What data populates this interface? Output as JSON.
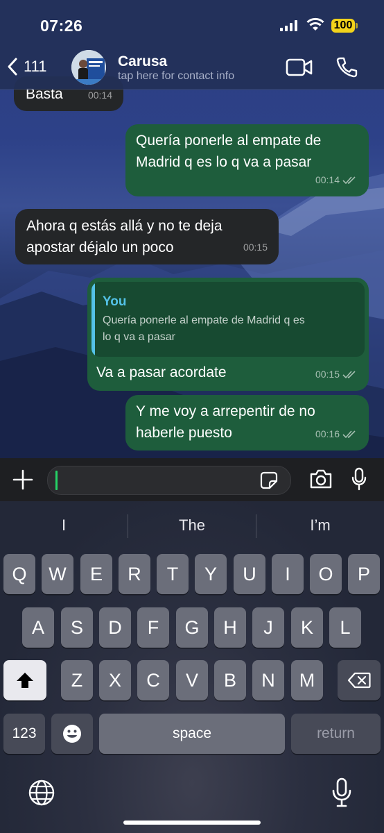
{
  "status_bar": {
    "time": "07:26",
    "battery": "100"
  },
  "header": {
    "back_count": "111",
    "contact_name": "Carusa",
    "contact_subtitle": "tap here for contact info"
  },
  "messages": [
    {
      "direction": "in",
      "text": "Basta",
      "time": "00:14"
    },
    {
      "direction": "out",
      "text": "Quería ponerle al empate de Madrid q es lo q va a pasar",
      "line1": "Quería ponerle al empate de",
      "line2": "Madrid q es lo q va a pasar",
      "time": "00:14"
    },
    {
      "direction": "in",
      "text": "Ahora q estás allá y no te deja apostar déjalo un poco",
      "line1": "Ahora q estás allá y no te deja",
      "line2": "apostar déjalo un poco",
      "time": "00:15"
    },
    {
      "direction": "out",
      "quote_author": "You",
      "quote_line1": "Quería ponerle al empate de Madrid q es",
      "quote_line2": "lo q va a pasar",
      "text": "Va a pasar acordate",
      "time": "00:15"
    },
    {
      "direction": "out",
      "text": "Y me voy a arrepentir de no haberle puesto",
      "line1": "Y me voy a arrepentir de no",
      "line2": "haberle puesto",
      "time": "00:16"
    }
  ],
  "composer": {
    "value": ""
  },
  "keyboard": {
    "suggestions": [
      "I",
      "The",
      "I’m"
    ],
    "row1": [
      "Q",
      "W",
      "E",
      "R",
      "T",
      "Y",
      "U",
      "I",
      "O",
      "P"
    ],
    "row2": [
      "A",
      "S",
      "D",
      "F",
      "G",
      "H",
      "J",
      "K",
      "L"
    ],
    "row3": [
      "Z",
      "X",
      "C",
      "V",
      "B",
      "N",
      "M"
    ],
    "numbers_key": "123",
    "space_key": "space",
    "return_key": "return"
  },
  "colors": {
    "outgoing_bubble": "#1e5d3c",
    "incoming_bubble": "#242628",
    "quote_accent": "#54c2e8",
    "battery": "#f2d31b",
    "cursor": "#25d366"
  },
  "icons": [
    "chevron-left-icon",
    "video-call-icon",
    "phone-icon",
    "plus-icon",
    "sticker-icon",
    "camera-icon",
    "microphone-icon",
    "shift-icon",
    "backspace-icon",
    "emoji-icon",
    "globe-icon",
    "read-receipt-icon"
  ]
}
